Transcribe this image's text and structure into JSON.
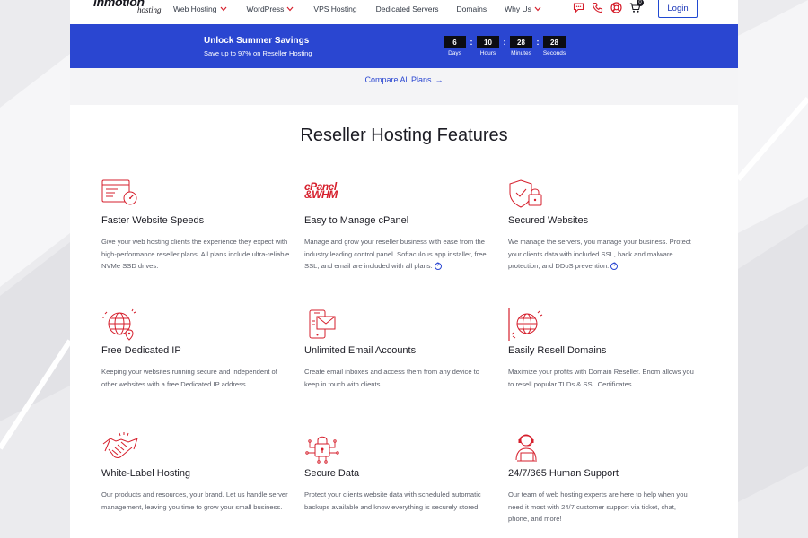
{
  "header": {
    "logo_brand": "inmotion",
    "logo_sub": "hosting",
    "nav": [
      {
        "label": "Web Hosting",
        "dropdown": true
      },
      {
        "label": "WordPress",
        "dropdown": true
      },
      {
        "label": "VPS Hosting",
        "dropdown": false
      },
      {
        "label": "Dedicated Servers",
        "dropdown": false
      },
      {
        "label": "Domains",
        "dropdown": false
      },
      {
        "label": "Why Us",
        "dropdown": true
      }
    ],
    "icons": [
      "chat-icon",
      "phone-icon",
      "support-lifebuoy-icon",
      "cart-icon"
    ],
    "cart_count": "0",
    "login_label": "Login"
  },
  "promo": {
    "title": "Unlock Summer Savings",
    "subtitle": "Save up to 97% on Reseller Hosting",
    "countdown": [
      {
        "value": "6",
        "label": "Days"
      },
      {
        "value": "10",
        "label": "Hours"
      },
      {
        "value": "28",
        "label": "Minutes"
      },
      {
        "value": "28",
        "label": "Seconds"
      }
    ],
    "separator": ":"
  },
  "compare": {
    "label": "Compare All Plans",
    "arrow": "→"
  },
  "features": {
    "title": "Reseller Hosting Features",
    "items": [
      {
        "icon": "speed-gauge-icon",
        "title": "Faster Website Speeds",
        "desc": "Give your web hosting clients the experience they expect with high-performance reseller plans. All plans include ultra-reliable NVMe SSD drives.",
        "info": false
      },
      {
        "icon": "cpanel-whm-logo-icon",
        "logo_text_1": "cPanel",
        "logo_text_2": "&WHM",
        "title": "Easy to Manage cPanel",
        "desc": "Manage and grow your reseller business with ease from the industry leading control panel. Softaculous app installer, free SSL, and email are included with all plans.",
        "info": true
      },
      {
        "icon": "shield-lock-icon",
        "title": "Secured Websites",
        "desc": "We manage the servers, you manage your business. Protect your clients data with included SSL, hack and malware protection, and DDoS prevention.",
        "info": true
      },
      {
        "icon": "globe-pin-icon",
        "title": "Free Dedicated IP",
        "desc": "Keeping your websites running secure and independent of other websites with a free Dedicated IP address.",
        "info": false
      },
      {
        "icon": "mobile-email-icon",
        "title": "Unlimited Email Accounts",
        "desc": "Create email inboxes and access them from any device to keep in touch with clients.",
        "info": false
      },
      {
        "icon": "domain-globe-icon",
        "title": "Easily Resell Domains",
        "desc": "Maximize your profits with Domain Reseller. Enom allows you to resell popular TLDs & SSL Certificates.",
        "info": false
      },
      {
        "icon": "handshake-icon",
        "title": "White-Label Hosting",
        "desc": "Our products and resources, your brand. Let us handle server management, leaving you time to grow your small business.",
        "info": false
      },
      {
        "icon": "secure-data-lock-icon",
        "title": "Secure Data",
        "desc": "Protect your clients website data with scheduled automatic backups available and know everything is securely stored.",
        "info": false
      },
      {
        "icon": "support-agent-icon",
        "title": "24/7/365 Human Support",
        "desc": "Our team of web hosting experts are here to help when you need it most with 24/7 customer support via ticket, chat, phone, and more!",
        "info": false
      }
    ],
    "info_mark": "?"
  },
  "colors": {
    "accent_blue": "#2a46d1",
    "icon_red": "#d61f2c",
    "text_dark": "#1c1c24",
    "text_muted": "#5b5f6a"
  }
}
